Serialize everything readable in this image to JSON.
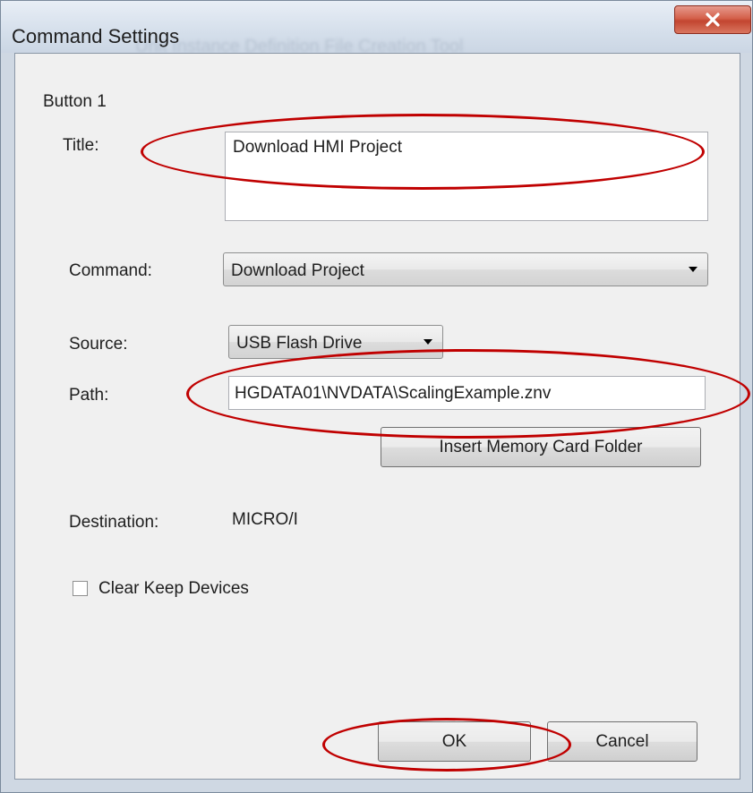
{
  "window": {
    "title": "Command Settings",
    "background_title": "Unit Instance Definition File Creation Tool",
    "close_icon": "close-x-icon"
  },
  "group": {
    "label": "Button 1"
  },
  "title_field": {
    "label": "Title:",
    "value": "Download HMI Project"
  },
  "command": {
    "label": "Command:",
    "selected": "Download Project"
  },
  "source": {
    "label": "Source:",
    "selected": "USB Flash Drive"
  },
  "path": {
    "label": "Path:",
    "value": "HGDATA01\\NVDATA\\ScalingExample.znv"
  },
  "insert_button": {
    "label": "Insert Memory Card Folder"
  },
  "destination": {
    "label": "Destination:",
    "value": "MICRO/I"
  },
  "clear_keep": {
    "label": "Clear Keep Devices",
    "checked": false
  },
  "footer": {
    "ok_label": "OK",
    "cancel_label": "Cancel"
  },
  "annotations": {
    "color": "#c00000"
  }
}
